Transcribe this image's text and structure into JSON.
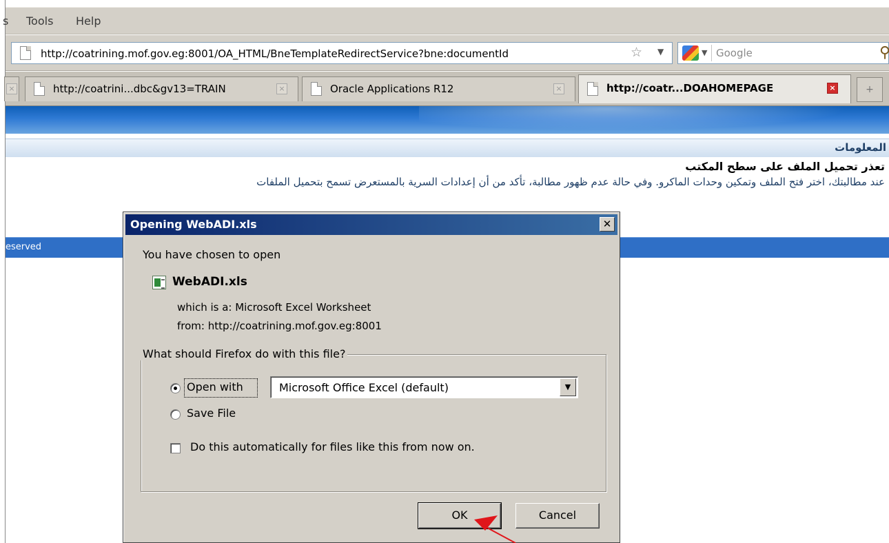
{
  "browser": {
    "menu": {
      "cut_item": "s",
      "tools": "Tools",
      "tools_hotkey": "T",
      "help": "Help",
      "help_hotkey": "H"
    },
    "url": "http://coatrining.mof.gov.eg:8001/OA_HTML/BneTemplateRedirectService?bne:documentId",
    "search_placeholder": "Google",
    "tabs": [
      {
        "label": "http://coatrini...dbc&gv13=TRAIN",
        "active": false
      },
      {
        "label": "Oracle Applications R12",
        "active": false
      },
      {
        "label": "http://coatr...DOAHOMEPAGE",
        "active": true
      }
    ]
  },
  "page": {
    "info_title": "المعلومات",
    "heading": "تعذر تحميل الملف على سطح المكتب",
    "body": "عند مطالبتك، اختر فتح الملف وتمكين وحدات الماكرو. وفي حالة عدم ظهور مطالبة، تأكد من أن إعدادات السرية بالمستعرض تسمح بتحميل الملفات",
    "footer_fragment": "eserved"
  },
  "dialog": {
    "title": "Opening WebADI.xls",
    "intro": "You have chosen to open",
    "filename": "WebADI.xls",
    "which_is": "which is a:  Microsoft Excel Worksheet",
    "from": "from:  http://coatrining.mof.gov.eg:8001",
    "question": "What should Firefox do with this file?",
    "open_with_label": "Open with",
    "open_with_value": "Microsoft Office Excel (default)",
    "save_file_label": "Save File",
    "auto_label": "Do this automatically for files like this from now on.",
    "ok": "OK",
    "cancel": "Cancel",
    "selected_option": "open_with",
    "auto_checked": false
  },
  "colors": {
    "title_bar_start": "#0a246a",
    "title_bar_end": "#3a6ea5",
    "annotation_arrow": "#e0161b"
  }
}
